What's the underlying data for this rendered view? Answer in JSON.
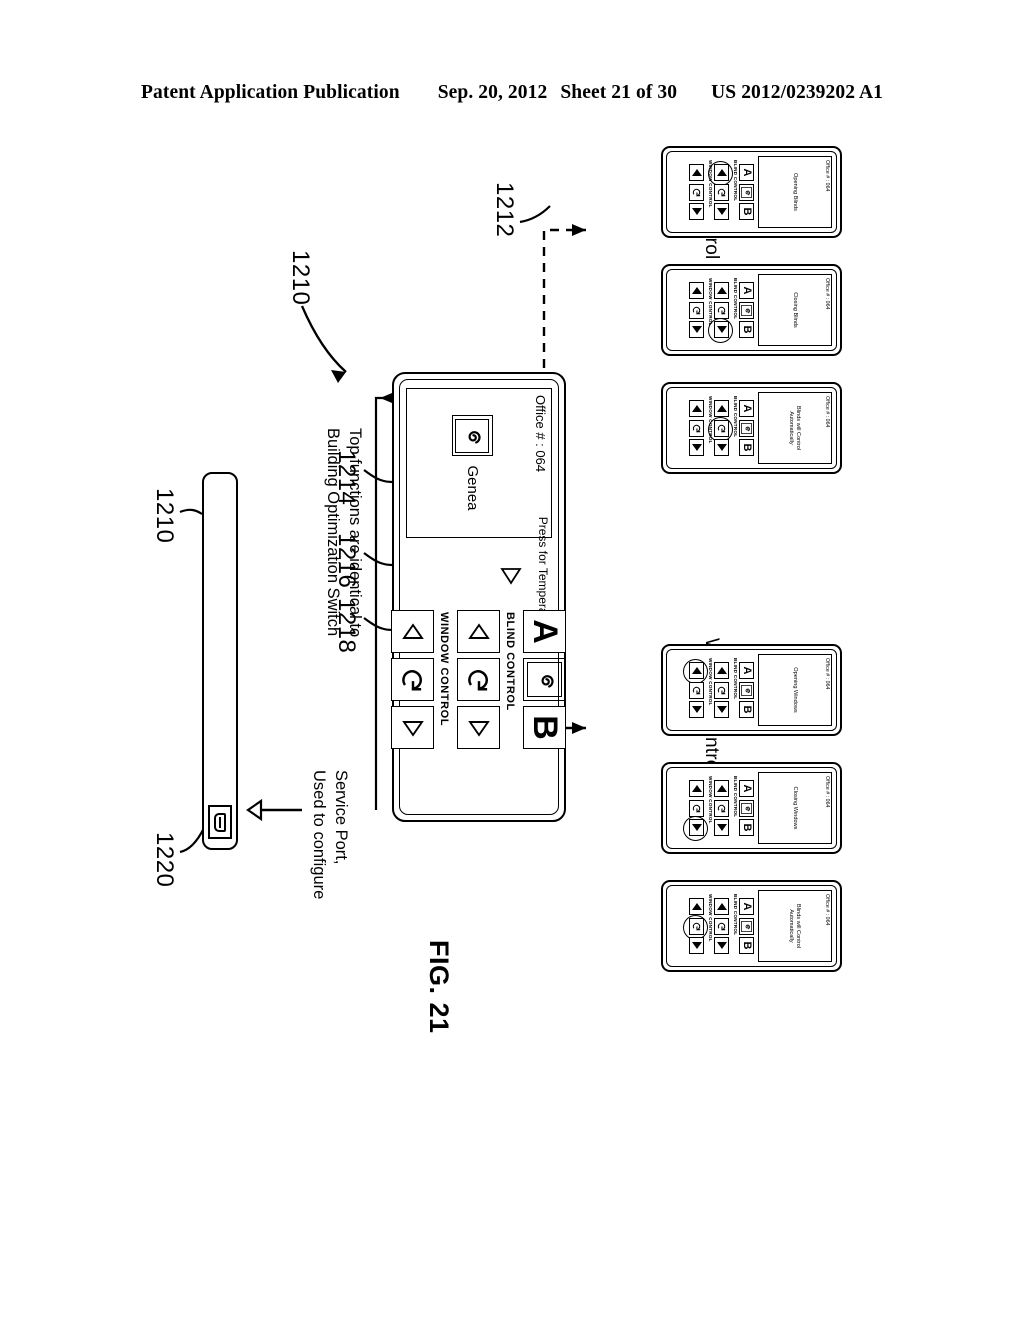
{
  "header": {
    "publication": "Patent Application Publication",
    "date": "Sep. 20, 2012",
    "sheet": "Sheet 21 of 30",
    "number": "US 2012/0239202 A1"
  },
  "figure": {
    "label": "FIG. 21"
  },
  "groups": [
    {
      "name": "blind-control",
      "label": "Blind Control",
      "devices": [
        {
          "office": "Office # : 064",
          "message": "Opening Blinds",
          "highlight": {
            "row": "blind",
            "button": "left"
          }
        },
        {
          "office": "Office # : 064",
          "message": "Closing Blinds",
          "highlight": {
            "row": "blind",
            "button": "right"
          }
        },
        {
          "office": "Office # : 064",
          "message": "Blinds will Control Automatically",
          "highlight": {
            "row": "blind",
            "button": "auto"
          }
        }
      ]
    },
    {
      "name": "window-control",
      "label": "Window Control",
      "devices": [
        {
          "office": "Office # : 064",
          "message": "Opening Windows",
          "highlight": {
            "row": "window",
            "button": "left"
          }
        },
        {
          "office": "Office # : 064",
          "message": "Closing Windows",
          "highlight": {
            "row": "window",
            "button": "right"
          }
        },
        {
          "office": "Office # : 064",
          "message": "Blinds will Control Automatically",
          "highlight": {
            "row": "window",
            "button": "auto"
          }
        }
      ]
    }
  ],
  "main_device": {
    "office": "Office # : 064",
    "brand": "Genea",
    "temperature_prompt": "Press for Temperature",
    "button_a": "A",
    "button_b": "B",
    "blind_control_label": "BLIND CONTROL",
    "window_control_label": "WINDOW CONTROL",
    "logo_icon": "genea-swirl-icon"
  },
  "callouts": {
    "device_main": "1210",
    "state_screens": "1212",
    "scene_buttons": "1214",
    "blind_control": "1216",
    "window_control": "1218",
    "device_edge": "1210",
    "service_port": "1220"
  },
  "annotations": {
    "top_functions": "Top functions are identical to Building Optimization Switch",
    "top_functions_line1": "Top functions are identical to",
    "top_functions_line2": "Building Optimization Switch",
    "service_port": "Service Port, Used to configure",
    "service_port_line1": "Service Port,",
    "service_port_line2": "Used to configure"
  },
  "colors": {
    "ink": "#000000",
    "paper": "#ffffff"
  }
}
